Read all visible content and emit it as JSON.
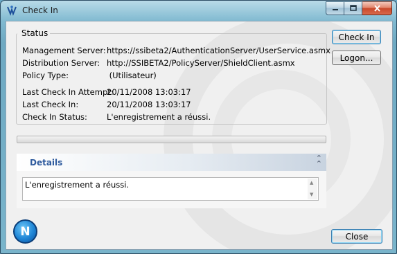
{
  "window": {
    "title": "Check In"
  },
  "status": {
    "legend": "Status",
    "rows": [
      {
        "label": "Management Server:",
        "value": "https://ssibeta2/AuthenticationServer/UserService.asmx"
      },
      {
        "label": "Distribution Server:",
        "value": "http://SSIBETA2/PolicyServer/ShieldClient.asmx"
      },
      {
        "label": "Policy Type:",
        "value": " (Utilisateur)"
      },
      {
        "label": "Last Check In Attempt:",
        "value": "20/11/2008 13:03:17"
      },
      {
        "label": "Last Check In:",
        "value": "20/11/2008 13:03:17"
      },
      {
        "label": "Check In Status:",
        "value": "L'enregistrement a réussi."
      }
    ]
  },
  "buttons": {
    "check_in": "Check In",
    "logon": "Logon...",
    "close": "Close"
  },
  "details": {
    "label": "Details",
    "text": "L'enregistrement a réussi."
  },
  "logo": {
    "glyph": "N"
  },
  "colors": {
    "details_label": "#2f5b9e",
    "close_button_red": "#c8482b"
  }
}
